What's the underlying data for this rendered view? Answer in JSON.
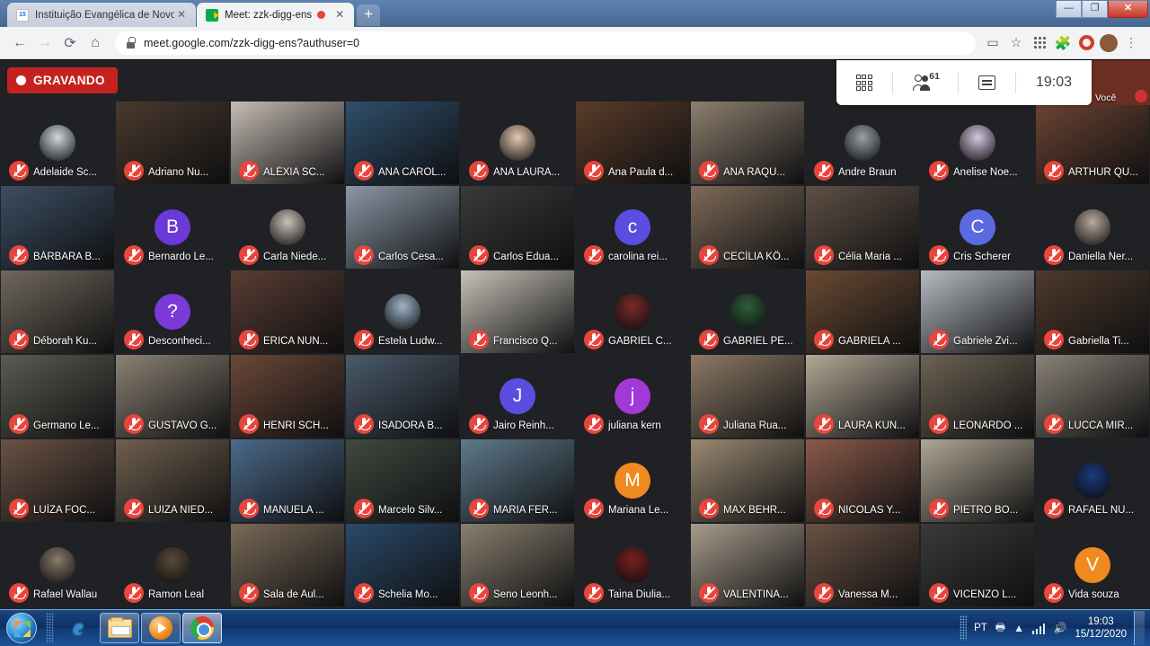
{
  "browser": {
    "tabs": [
      {
        "title": "Instituição Evangélica de Novo H",
        "favicon": "calendar-icon",
        "active": false,
        "recording": false
      },
      {
        "title": "Meet: zzk-digg-ens",
        "favicon": "meet-icon",
        "active": true,
        "recording": true
      }
    ],
    "new_tab_label": "+",
    "close_label": "✕",
    "url": "meet.google.com/zzk-digg-ens?authuser=0",
    "back_label": "←",
    "forward_label": "→",
    "reload_label": "⟳",
    "home_label": "⌂",
    "window_minimize": "—",
    "window_restore": "❐",
    "window_close": "✕"
  },
  "meet": {
    "recording_label": "GRAVANDO",
    "participant_count": "61",
    "time": "19:03",
    "self_label": "Você",
    "participants": [
      {
        "name": "Adelaide Sc...",
        "type": "photo",
        "bg": "#1b2a1e",
        "av": "#cfd8dc"
      },
      {
        "name": "Adriano Nu...",
        "type": "video",
        "bg": "#4a3a2e"
      },
      {
        "name": "ALÉXIA SC...",
        "type": "video",
        "bg": "#c7bdb4"
      },
      {
        "name": "ANA CAROL...",
        "type": "video",
        "bg": "#2f4f6b"
      },
      {
        "name": "ANA LAURA...",
        "type": "photo",
        "bg": "#202124",
        "av": "#e8c9b0"
      },
      {
        "name": "Ana Paula d...",
        "type": "video",
        "bg": "#5a3c2a"
      },
      {
        "name": "ANA RAQU...",
        "type": "video",
        "bg": "#8d7f6e"
      },
      {
        "name": "Andre Braun",
        "type": "photo",
        "bg": "#202124",
        "av": "#9aa0a6"
      },
      {
        "name": "Anelise Noe...",
        "type": "photo",
        "bg": "#202124",
        "av": "#d5c6e0"
      },
      {
        "name": "ARTHUR QU...",
        "type": "video",
        "bg": "#6d4433"
      },
      {
        "name": "BÁRBARA B...",
        "type": "video",
        "bg": "#3c4f63"
      },
      {
        "name": "Bernardo Le...",
        "type": "letter",
        "letter": "B",
        "color": "#6a39d7"
      },
      {
        "name": "Carla Niede...",
        "type": "photo",
        "bg": "#202124",
        "av": "#c9c2b8"
      },
      {
        "name": "Carlos Cesa...",
        "type": "video",
        "bg": "#8b98a6"
      },
      {
        "name": "Carlos Edua...",
        "type": "video",
        "bg": "#3a3a3a"
      },
      {
        "name": "carolina rei...",
        "type": "letter",
        "letter": "c",
        "color": "#5b4de0"
      },
      {
        "name": "CECÍLIA KÖ...",
        "type": "video",
        "bg": "#7e6a58"
      },
      {
        "name": "Célia Maria ...",
        "type": "video",
        "bg": "#5f5045"
      },
      {
        "name": "Cris Scherer",
        "type": "letter",
        "letter": "C",
        "color": "#5b6ae0"
      },
      {
        "name": "Daniella Ner...",
        "type": "photo",
        "bg": "#202124",
        "av": "#b8a99b"
      },
      {
        "name": "Déborah Ku...",
        "type": "video",
        "bg": "#70685c"
      },
      {
        "name": "Desconheci...",
        "type": "letter",
        "letter": "?",
        "color": "#7b39d7"
      },
      {
        "name": "ERICA NUN...",
        "type": "video",
        "bg": "#5a3d34"
      },
      {
        "name": "Estela Ludw...",
        "type": "photo",
        "bg": "#202124",
        "av": "#9fb6c9"
      },
      {
        "name": "Francisco Q...",
        "type": "video",
        "bg": "#c7c2b8"
      },
      {
        "name": "GABRIEL C...",
        "type": "photo",
        "bg": "#202124",
        "av": "#7a2a2a"
      },
      {
        "name": "GABRIEL PE...",
        "type": "photo",
        "bg": "#202124",
        "av": "#2f5f3a"
      },
      {
        "name": "GABRIELA ...",
        "type": "video",
        "bg": "#6a4a33"
      },
      {
        "name": "Gabriele Zvi...",
        "type": "video",
        "bg": "#b7bcc2"
      },
      {
        "name": "Gabriella Ti...",
        "type": "video",
        "bg": "#4e3a2c"
      },
      {
        "name": "Germano Le...",
        "type": "video",
        "bg": "#5c5c52"
      },
      {
        "name": "GUSTAVO G...",
        "type": "video",
        "bg": "#8c8274"
      },
      {
        "name": "HENRI SCH...",
        "type": "video",
        "bg": "#6b4838"
      },
      {
        "name": "ISADORA B...",
        "type": "video",
        "bg": "#4a5a6a"
      },
      {
        "name": "Jairo Reinh...",
        "type": "letter",
        "letter": "J",
        "color": "#5b4de0"
      },
      {
        "name": "juliana kern",
        "type": "letter",
        "letter": "j",
        "color": "#a238d6"
      },
      {
        "name": "Juliana Rua...",
        "type": "video",
        "bg": "#8d7a66"
      },
      {
        "name": "LAURA KUN...",
        "type": "video",
        "bg": "#b4a896"
      },
      {
        "name": "LEONARDO ...",
        "type": "video",
        "bg": "#6d6354"
      },
      {
        "name": "LUCCA MIR...",
        "type": "video",
        "bg": "#8a8276"
      },
      {
        "name": "LUÍZA FOC...",
        "type": "video",
        "bg": "#6a5244"
      },
      {
        "name": "LUIZA NIED...",
        "type": "video",
        "bg": "#70604f"
      },
      {
        "name": "MANUELA ...",
        "type": "video",
        "bg": "#4c6a8a"
      },
      {
        "name": "Marcelo Silv...",
        "type": "video",
        "bg": "#3f4a40"
      },
      {
        "name": "MARIA FER...",
        "type": "video",
        "bg": "#5f7a8c"
      },
      {
        "name": "Mariana Le...",
        "type": "letter",
        "letter": "M",
        "color": "#ef8a20"
      },
      {
        "name": "MAX BEHR...",
        "type": "video",
        "bg": "#9a8a72"
      },
      {
        "name": "NICOLAS Y...",
        "type": "video",
        "bg": "#8b5a4a"
      },
      {
        "name": "PIETRO BO...",
        "type": "video",
        "bg": "#b0a694"
      },
      {
        "name": "RAFAEL NU...",
        "type": "photo",
        "bg": "#202124",
        "av": "#1a3a7a"
      },
      {
        "name": "Rafael Wallau",
        "type": "photo",
        "bg": "#202124",
        "av": "#8a7a6a"
      },
      {
        "name": "Ramon Leal",
        "type": "photo",
        "bg": "#202124",
        "av": "#5a4a3a"
      },
      {
        "name": "Sala de Aul...",
        "type": "video",
        "bg": "#7a6a58"
      },
      {
        "name": "Schelia Mo...",
        "type": "video",
        "bg": "#2b4a6a"
      },
      {
        "name": "Seno Leonh...",
        "type": "video",
        "bg": "#8a8070"
      },
      {
        "name": "Taina Diulia...",
        "type": "photo",
        "bg": "#202124",
        "av": "#7a2020"
      },
      {
        "name": "VALENTINA...",
        "type": "video",
        "bg": "#a89c8c"
      },
      {
        "name": "Vanessa M...",
        "type": "video",
        "bg": "#6a5244"
      },
      {
        "name": "VICENZO L...",
        "type": "video",
        "bg": "#3a3a3a"
      },
      {
        "name": "Vida souza",
        "type": "letter",
        "letter": "V",
        "color": "#ef8a20"
      }
    ]
  },
  "taskbar": {
    "apps": [
      "internet-explorer",
      "file-explorer",
      "media-player",
      "google-chrome"
    ],
    "language": "PT",
    "time": "19:03",
    "date": "15/12/2020"
  }
}
